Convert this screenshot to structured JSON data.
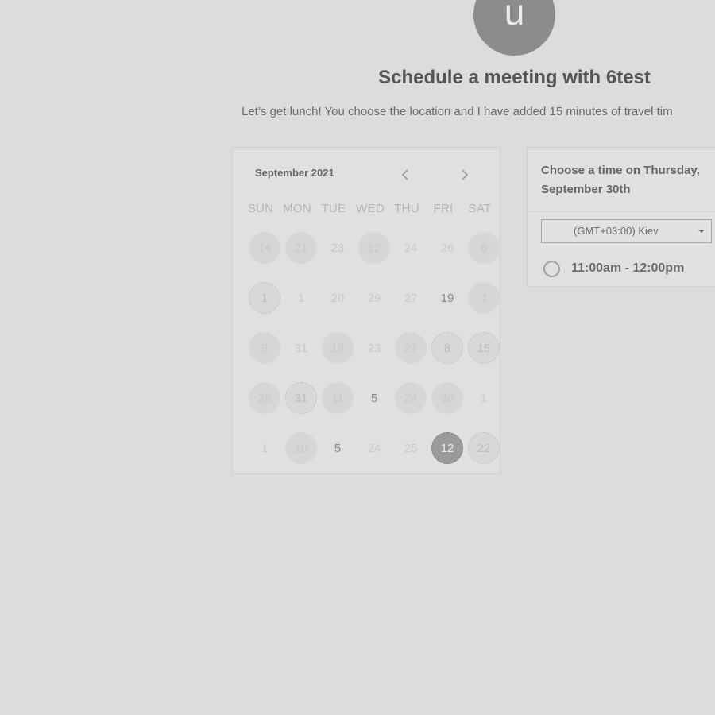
{
  "header": {
    "avatar_initial": "u",
    "title": "Schedule a meeting with 6test",
    "description": "Let’s get lunch! You choose the location and I have added 15 minutes of travel tim"
  },
  "calendar": {
    "month_label": "September 2021",
    "prev_icon": "chevron-left-icon",
    "next_icon": "chevron-right-icon",
    "weekdays": [
      "SUN",
      "MON",
      "TUE",
      "WED",
      "THU",
      "FRI",
      "SAT"
    ],
    "weeks": [
      [
        {
          "label": "14",
          "style": "filled"
        },
        {
          "label": "21",
          "style": "filled"
        },
        {
          "label": "23",
          "style": "plain"
        },
        {
          "label": "12",
          "style": "filled"
        },
        {
          "label": "24",
          "style": "plain"
        },
        {
          "label": "26",
          "style": "plain"
        },
        {
          "label": "6",
          "style": "filled"
        }
      ],
      [
        {
          "label": "1",
          "style": "dotted"
        },
        {
          "label": "1",
          "style": "plain"
        },
        {
          "label": "20",
          "style": "plain"
        },
        {
          "label": "29",
          "style": "plain"
        },
        {
          "label": "27",
          "style": "plain"
        },
        {
          "label": "19",
          "style": "dark"
        },
        {
          "label": "4",
          "style": "filled"
        }
      ],
      [
        {
          "label": "5",
          "style": "filled"
        },
        {
          "label": "31",
          "style": "plain"
        },
        {
          "label": "19",
          "style": "filled"
        },
        {
          "label": "23",
          "style": "plain"
        },
        {
          "label": "27",
          "style": "filled"
        },
        {
          "label": "8",
          "style": "dotted"
        },
        {
          "label": "15",
          "style": "dotted"
        }
      ],
      [
        {
          "label": "28",
          "style": "filled"
        },
        {
          "label": "31",
          "style": "dotted"
        },
        {
          "label": "11",
          "style": "filled"
        },
        {
          "label": "5",
          "style": "dark"
        },
        {
          "label": "24",
          "style": "filled"
        },
        {
          "label": "30",
          "style": "filled"
        },
        {
          "label": "1",
          "style": "plain"
        }
      ],
      [
        {
          "label": "1",
          "style": "plain"
        },
        {
          "label": "10",
          "style": "filled"
        },
        {
          "label": "5",
          "style": "dark"
        },
        {
          "label": "24",
          "style": "plain"
        },
        {
          "label": "25",
          "style": "plain"
        },
        {
          "label": "12",
          "style": "selected"
        },
        {
          "label": "22",
          "style": "dotted"
        }
      ]
    ]
  },
  "time_picker": {
    "heading": "Choose a time on Thursday, September 30th",
    "timezone": "(GMT+03:00) Kiev",
    "slots": [
      {
        "label": "11:00am - 12:00pm",
        "selected": false
      }
    ]
  },
  "colors": {
    "background": "#dcdcdc",
    "card": "#e0e0e0",
    "selected_day": "#9a9a9a",
    "avatar": "#8c8c8c"
  }
}
